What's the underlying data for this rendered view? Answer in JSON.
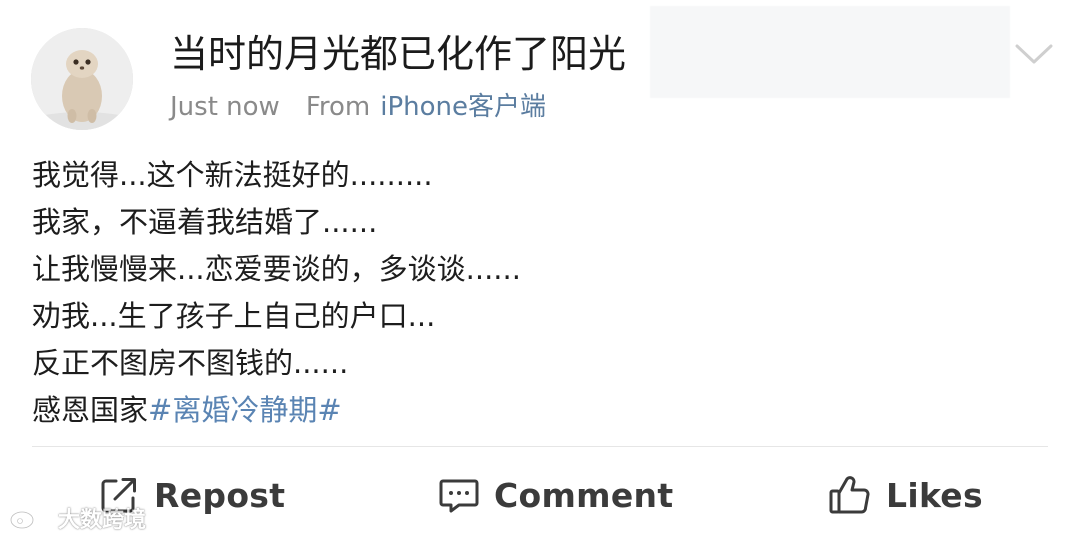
{
  "post": {
    "author": "当时的月光都已化作了阳光",
    "timestamp": "Just now",
    "source_prefix": "From",
    "source_client": "iPhone客户端",
    "body_lines": [
      "我觉得...这个新法挺好的.........",
      "我家，不逼着我结婚了......",
      "让我慢慢来...恋爱要谈的，多谈谈......",
      "劝我...生了孩子上自己的户口...",
      "反正不图房不图钱的......"
    ],
    "last_line_prefix": "感恩国家",
    "hashtag": "#离婚冷静期#"
  },
  "actions": {
    "repost_label": "Repost",
    "comment_label": "Comment",
    "like_label": "Likes"
  },
  "icons": {
    "menu": "chevron-down-icon",
    "repost": "repost-icon",
    "comment": "comment-icon",
    "like": "thumbs-up-icon"
  },
  "watermark": {
    "text": "大数跨境"
  },
  "colors": {
    "hashtag": "#5a84b3",
    "source_client": "#5b7da0",
    "meta": "#8a8a8a",
    "action_text": "#3b3b3b"
  }
}
